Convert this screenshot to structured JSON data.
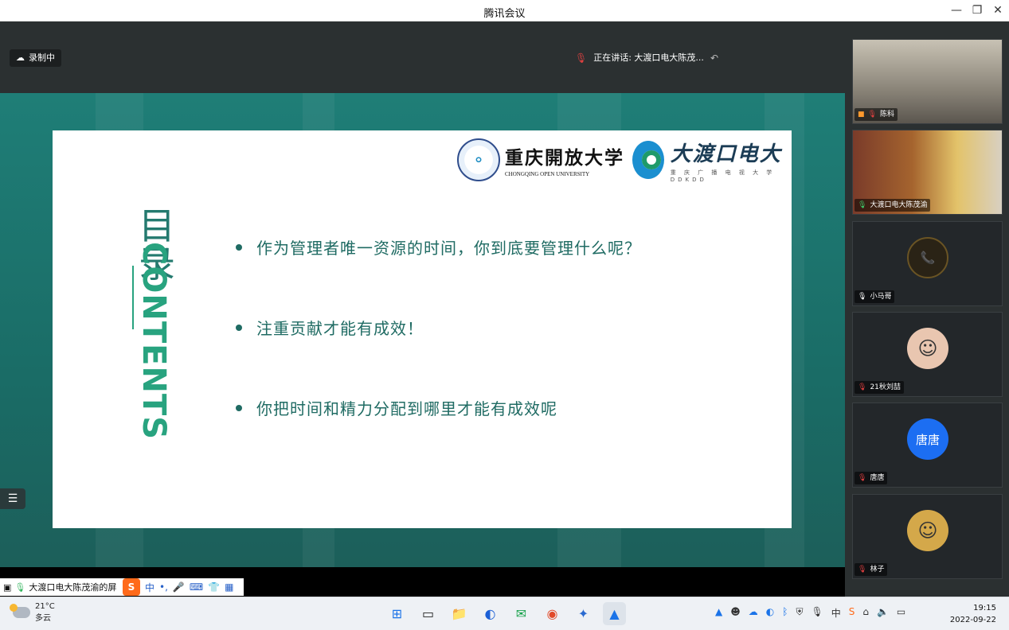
{
  "window": {
    "title": "腾讯会议",
    "min": "—",
    "restore": "❐",
    "close": "✕"
  },
  "meeting": {
    "recording_label": "录制中",
    "speaking_label": "正在讲话: 大渡口电大陈茂..."
  },
  "slide": {
    "logo_cq_cn": "重庆開放大学",
    "logo_cq_en": "CHONGQING OPEN UNIVERSITY",
    "logo_dd_cn": "大渡口电大",
    "logo_dd_sub": "重 庆 广 播 电 视 大 学 DDKDD",
    "mulu": "目录",
    "contents": "CONTENTS",
    "bullets": [
      "作为管理者唯一资源的时间，你到底要管理什么呢？",
      "注重贡献才能有成效！",
      "你把时间和精力分配到哪里才能有成效呢"
    ]
  },
  "participants": [
    {
      "name": "陈科",
      "type": "video",
      "bg": "#8a8478"
    },
    {
      "name": "大渡口电大陈茂渝",
      "type": "video",
      "bg": "#6b4a2e"
    },
    {
      "name": "小马哥",
      "type": "avatar",
      "avatar_text": "📞",
      "avatar_color": "#2a2316"
    },
    {
      "name": "21秋刘喆",
      "type": "avatar",
      "avatar_text": "☺",
      "avatar_color": "#e9c6b0"
    },
    {
      "name": "唐唐",
      "type": "avatar",
      "avatar_text": "唐唐",
      "avatar_color": "#1c6ef2"
    },
    {
      "name": "林子",
      "type": "avatar",
      "avatar_text": "☺",
      "avatar_color": "#d4a84a"
    }
  ],
  "share_bar": {
    "label": "大渡口电大陈茂渝的屏"
  },
  "ime": {
    "logo": "S",
    "items": [
      "中",
      "•,",
      "🎤",
      "⌨",
      "👕",
      "▦"
    ]
  },
  "taskbar": {
    "weather_temp": "21°C",
    "weather_desc": "多云",
    "time": "19:15",
    "date": "2022-09-22"
  },
  "colors": {
    "accent": "#1f7e77",
    "slide_text": "#1f6b63",
    "contents_green": "#28a37f"
  }
}
